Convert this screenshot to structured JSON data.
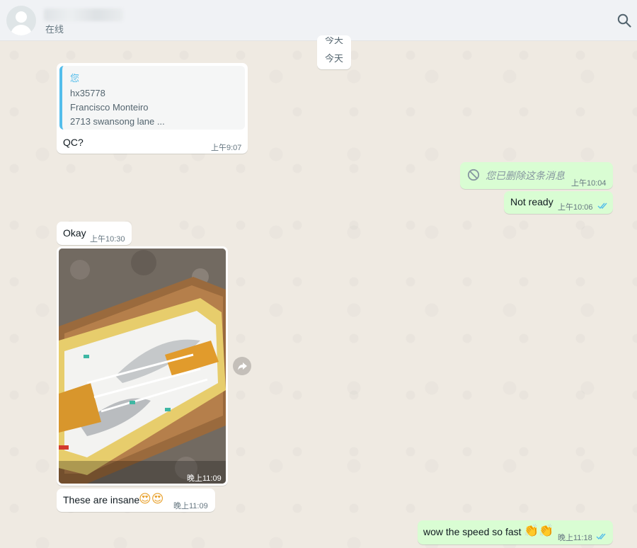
{
  "header": {
    "status": "在线"
  },
  "date_chip": {
    "ghost": "今天",
    "label": "今天"
  },
  "messages": {
    "m1": {
      "quote_author": "您",
      "quote_line1": "hx35778",
      "quote_line2": "Francisco Monteiro",
      "quote_line3": "2713 swansong lane ...",
      "text": "QC?",
      "time": "上午9:07"
    },
    "m2": {
      "text": "您已删除这条消息",
      "time": "上午10:04"
    },
    "m3": {
      "text": "Not ready",
      "time": "上午10:06"
    },
    "m4": {
      "text": "Okay",
      "time": "上午10:30"
    },
    "m5": {
      "time": "晚上11:09"
    },
    "m6": {
      "text": "These are insane",
      "emoji": "😍😍",
      "time": "晚上11:09"
    },
    "m7": {
      "text": "wow the speed so fast",
      "emoji": "👏👏",
      "time": "晚上11:18"
    }
  },
  "icons": {
    "search": "search-icon",
    "forward": "forward-icon",
    "deleted": "blocked-icon",
    "read_receipt": "double-check-icon"
  },
  "colors": {
    "chat_background": "#efeae2",
    "incoming_bubble": "#ffffff",
    "outgoing_bubble": "#d9fdd3",
    "read_ticks": "#53bdeb",
    "quote_accent": "#53bdeb"
  }
}
